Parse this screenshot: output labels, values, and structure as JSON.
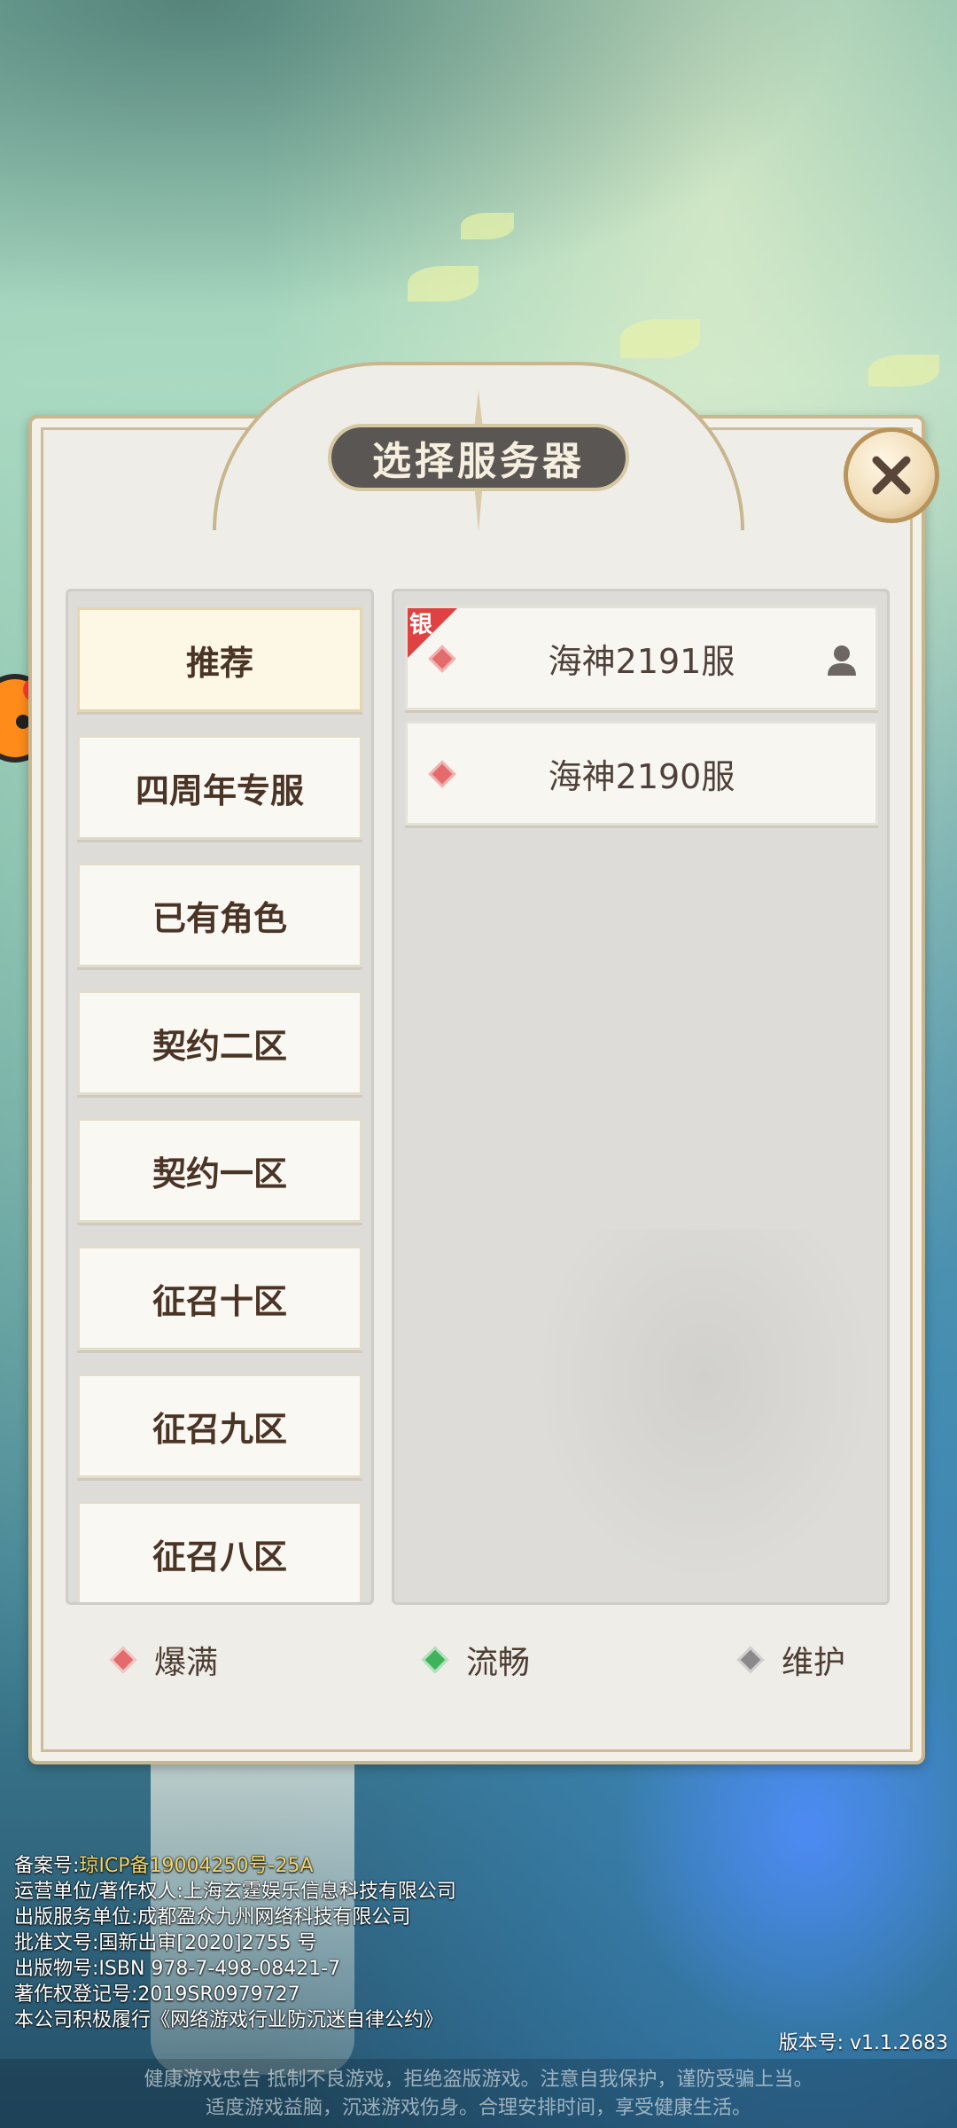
{
  "dialog": {
    "title": "选择服务器"
  },
  "categories": [
    {
      "label": "推荐",
      "active": true
    },
    {
      "label": "四周年专服"
    },
    {
      "label": "已有角色"
    },
    {
      "label": "契约二区"
    },
    {
      "label": "契约一区"
    },
    {
      "label": "征召十区"
    },
    {
      "label": "征召九区"
    },
    {
      "label": "征召八区"
    }
  ],
  "servers": [
    {
      "name": "海神2191服",
      "tag": "银",
      "status": "爆满",
      "has_role": true
    },
    {
      "name": "海神2190服",
      "status": "爆满"
    }
  ],
  "legend": [
    {
      "label": "爆满",
      "color": "#e36b6b"
    },
    {
      "label": "流畅",
      "color": "#3fb35a"
    },
    {
      "label": "维护",
      "color": "#8a8a8a"
    }
  ],
  "footer": {
    "record_label": "备案号:",
    "record_value": "琼ICP备19004250号-25A",
    "lines": [
      "运营单位/著作权人:上海玄霆娱乐信息科技有限公司",
      "出版服务单位:成都盈众九州网络科技有限公司",
      "批准文号:国新出审[2020]2755 号",
      "出版物号:ISBN 978-7-498-08421-7",
      "著作权登记号:2019SR0979727",
      "本公司积极履行《网络游戏行业防沉迷自律公约》"
    ],
    "version": "版本号: v1.1.2683",
    "health_line1": "健康游戏忠告   抵制不良游戏，拒绝盗版游戏。注意自我保护，谨防受骗上当。",
    "health_line2": "适度游戏益脑，沉迷游戏伤身。合理安排时间，享受健康生活。"
  },
  "colors": {
    "panel_bg": "#efede8",
    "title_bg": "#5a5653",
    "full": "#e36b6b",
    "smooth": "#3fb35a",
    "maintain": "#8a8a8a"
  }
}
